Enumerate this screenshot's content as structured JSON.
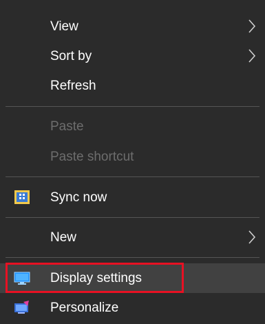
{
  "menu": {
    "items": [
      {
        "label": "View",
        "submenu": true,
        "enabled": true
      },
      {
        "label": "Sort by",
        "submenu": true,
        "enabled": true
      },
      {
        "label": "Refresh",
        "submenu": false,
        "enabled": true
      },
      {
        "label": "Paste",
        "submenu": false,
        "enabled": false
      },
      {
        "label": "Paste shortcut",
        "submenu": false,
        "enabled": false
      },
      {
        "label": "Sync now",
        "submenu": false,
        "enabled": true,
        "icon": "sync-app-icon"
      },
      {
        "label": "New",
        "submenu": true,
        "enabled": true
      },
      {
        "label": "Display settings",
        "submenu": false,
        "enabled": true,
        "icon": "display-icon",
        "highlighted": true
      },
      {
        "label": "Personalize",
        "submenu": false,
        "enabled": true,
        "icon": "personalize-icon"
      }
    ]
  },
  "colors": {
    "menu_background": "#2b2b2b",
    "hover_background": "#414141",
    "disabled_text": "#6d6d6d",
    "highlight_border": "#e81123"
  }
}
